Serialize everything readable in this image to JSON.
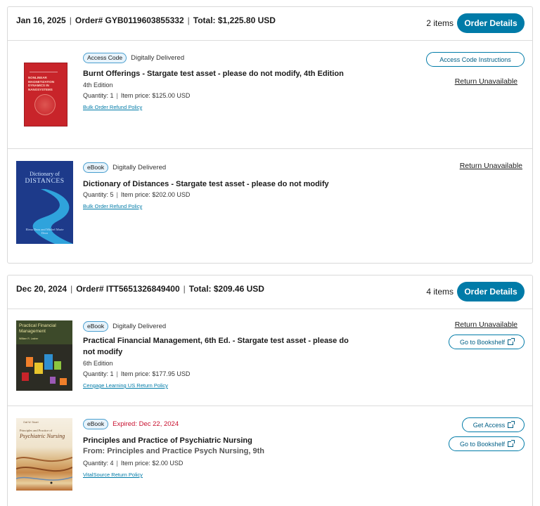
{
  "orders": [
    {
      "date": "Jan 16, 2025",
      "order_label": "Order# GYB0119603855332",
      "total_label": "Total: $1,225.80 USD",
      "item_count": "2 items",
      "details_button": "Order Details",
      "items": [
        {
          "badge": "Access Code",
          "delivery": "Digitally Delivered",
          "title": "Burnt Offerings - Stargate test asset - please do not modify, 4th Edition",
          "edition": "4th Edition",
          "quantity": "Quantity: 1",
          "price": "Item price: $125.00 USD",
          "policy": "Bulk Order Refund Policy",
          "action_button": "Access Code Instructions",
          "return": "Return Unavailable",
          "cover_text": "NONLINEAR MAGNETIZATION DYNAMICS IN NANOSYSTEMS",
          "cover_color": "#c8242a"
        },
        {
          "badge": "eBook",
          "delivery": "Digitally Delivered",
          "title": "Dictionary of Distances - Stargate test asset - please do not modify",
          "quantity": "Quantity: 5",
          "price": "Item price: $202.00 USD",
          "policy": "Bulk Order Refund Policy",
          "return": "Return Unavailable",
          "cover_title_1": "Dictionary of",
          "cover_title_2": "DISTANCES",
          "cover_authors": "Elena Deza and Michel Marie Deza",
          "cover_color": "#1d3a8a"
        }
      ]
    },
    {
      "date": "Dec 20, 2024",
      "order_label": "Order# ITT5651326849400",
      "total_label": "Total: $209.46 USD",
      "item_count": "4 items",
      "details_button": "Order Details",
      "items": [
        {
          "badge": "eBook",
          "delivery": "Digitally Delivered",
          "title": "Practical Financial Management, 6th Ed. - Stargate test asset - please do not modify",
          "edition": "6th Edition",
          "quantity": "Quantity: 1",
          "price": "Item price: $177.95 USD",
          "policy": "Cengage Learning US Return Policy",
          "return": "Return Unavailable",
          "action_button": "Go to Bookshelf",
          "cover_title": "Practical Financial Management",
          "cover_author": "William R. Lasher"
        },
        {
          "badge": "eBook",
          "delivery": "Expired: Dec 22, 2024",
          "title": "Principles and Practice of Psychiatric Nursing",
          "subtitle": "From: Principles and Practice Psych Nursing, 9th",
          "quantity": "Quantity: 4",
          "price": "Item price: $2.00 USD",
          "policy": "VitalSource Return Policy",
          "action_button_1": "Get Access",
          "action_button_2": "Go to Bookshelf",
          "cover_title_1": "Principles and Practice of",
          "cover_title_2": "Psychiatric Nursing",
          "cover_author": "Gail W. Stuart"
        }
      ]
    }
  ],
  "colors": {
    "accent": "#007ba8",
    "expired": "#c8102e",
    "badge_bg": "#e7f3fb"
  }
}
